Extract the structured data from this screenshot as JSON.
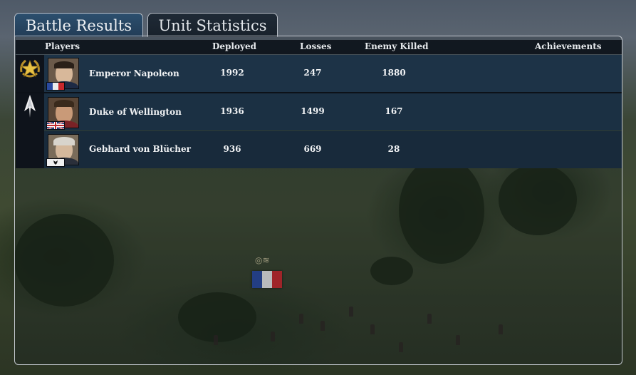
{
  "tabs": [
    {
      "label": "Battle Results",
      "active": true
    },
    {
      "label": "Unit Statistics",
      "active": false
    }
  ],
  "columns": {
    "players": "Players",
    "deployed": "Deployed",
    "losses": "Losses",
    "enemy_killed": "Enemy Killed",
    "achievements": "Achievements"
  },
  "teams": [
    {
      "emblem": "gold-star-laurel-icon"
    },
    {
      "emblem": "white-arrowhead-icon"
    }
  ],
  "players": [
    {
      "name": "Emperor Napoleon",
      "flag": "france-flag-icon",
      "deployed": "1992",
      "losses": "247",
      "enemy_killed": "1880",
      "achievements": ""
    },
    {
      "name": "Duke of Wellington",
      "flag": "union-jack-flag-icon",
      "deployed": "1936",
      "losses": "1499",
      "enemy_killed": "167",
      "achievements": ""
    },
    {
      "name": "Gebhard von Blücher",
      "flag": "prussia-flag-icon",
      "deployed": "936",
      "losses": "669",
      "enemy_killed": "28",
      "achievements": ""
    }
  ],
  "colors": {
    "france_blue": "#2a4aa0",
    "france_red": "#c8282c",
    "uk_blue": "#1f3a7a",
    "uk_red": "#c0282c",
    "gold": "#d9b43a"
  }
}
